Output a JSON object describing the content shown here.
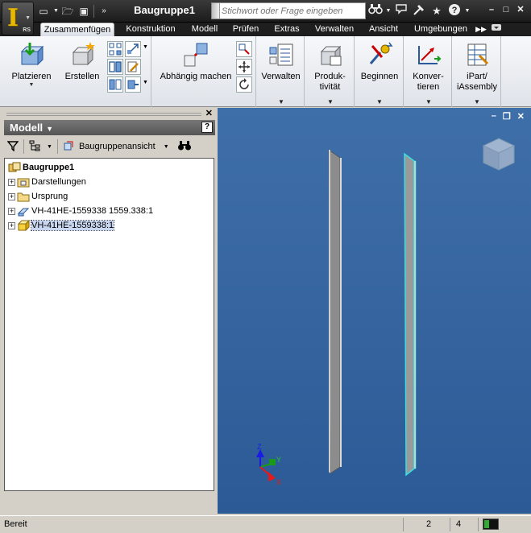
{
  "app": {
    "logo_letter": "I",
    "logo_sub": "RS",
    "document_title": "Baugruppe1"
  },
  "search": {
    "placeholder": "Stichwort oder Frage eingeben"
  },
  "tabs": [
    {
      "label": "Zusammenfügen",
      "active": true
    },
    {
      "label": "Konstruktion"
    },
    {
      "label": "Modell"
    },
    {
      "label": "Prüfen"
    },
    {
      "label": "Extras"
    },
    {
      "label": "Verwalten"
    },
    {
      "label": "Ansicht"
    },
    {
      "label": "Umgebungen"
    }
  ],
  "ribbon": {
    "platzieren": "Platzieren",
    "erstellen": "Erstellen",
    "abhaengig": "Abhängig machen",
    "verwalten": "Verwalten",
    "produktivitaet_1": "Produk-",
    "produktivitaet_2": "tivität",
    "beginnen": "Beginnen",
    "konvertieren_1": "Konver-",
    "konvertieren_2": "tieren",
    "ipart_1": "iPart/",
    "ipart_2": "iAssembly"
  },
  "browser": {
    "title": "Model",
    "title_full": "Modell",
    "view_dropdown": "Baugruppenansicht",
    "tree": {
      "root": "Baugruppe1",
      "items": [
        {
          "label": "Darstellungen"
        },
        {
          "label": "Ursprung"
        },
        {
          "label": "VH-41HE-1559338 1559.338:1"
        },
        {
          "label": "VH-41HE-1559338:1",
          "selected": true
        }
      ]
    }
  },
  "status": {
    "text": "Bereit",
    "num1": "2",
    "num2": "4"
  },
  "colors": {
    "viewport": "#3a689f",
    "accent": "#e8b800",
    "selected_edge": "#33e6e6"
  }
}
